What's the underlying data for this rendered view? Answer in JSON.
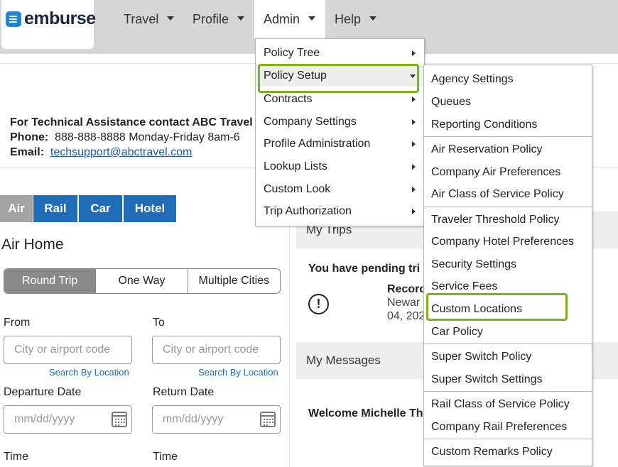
{
  "logo": {
    "text": "emburse",
    "brand_color": "#1b86d6"
  },
  "nav": [
    {
      "label": "Travel"
    },
    {
      "label": "Profile"
    },
    {
      "label": "Admin"
    },
    {
      "label": "Help"
    }
  ],
  "assistance": {
    "line1": "For Technical Assistance contact ABC Travel",
    "phone_label": "Phone:",
    "phone_value": "888-888-8888 Monday-Friday 8am-6",
    "email_label": "Email:",
    "email_value": "techsupport@abctravel.com"
  },
  "mode_tabs": [
    {
      "label": "Air",
      "active": true
    },
    {
      "label": "Rail"
    },
    {
      "label": "Car"
    },
    {
      "label": "Hotel"
    }
  ],
  "air_home": {
    "title": "Air Home",
    "trip_types": [
      "Round Trip",
      "One Way",
      "Multiple Cities"
    ],
    "from_label": "From",
    "to_label": "To",
    "from_placeholder": "City or airport code",
    "to_placeholder": "City or airport code",
    "search_by_location": "Search By Location",
    "departure_label": "Departure Date",
    "return_label": "Return Date",
    "date_placeholder": "mm/dd/yyyy",
    "time_label": "Time"
  },
  "right": {
    "my_trips": "My Trips",
    "pending_text": "You have pending tri",
    "record": "Record",
    "newark": "Newar",
    "date_partial": "04, 202",
    "my_messages": "My Messages",
    "welcome": "Welcome Michelle Th"
  },
  "admin_menu": [
    {
      "label": "Policy Tree"
    },
    {
      "label": "Policy Setup"
    },
    {
      "label": "Contracts"
    },
    {
      "label": "Company Settings"
    },
    {
      "label": "Profile Administration"
    },
    {
      "label": "Lookup Lists"
    },
    {
      "label": "Custom Look"
    },
    {
      "label": "Trip Authorization"
    }
  ],
  "policy_setup_menu": [
    {
      "label": "Agency Settings"
    },
    {
      "label": "Queues"
    },
    {
      "label": "Reporting Conditions"
    },
    {
      "label": "Air Reservation Policy"
    },
    {
      "label": "Company Air Preferences"
    },
    {
      "label": "Air Class of Service Policy"
    },
    {
      "label": "Traveler Threshold Policy"
    },
    {
      "label": "Company Hotel Preferences"
    },
    {
      "label": "Security Settings"
    },
    {
      "label": "Service Fees"
    },
    {
      "label": "Custom Locations"
    },
    {
      "label": "Car Policy"
    },
    {
      "label": "Super Switch Policy"
    },
    {
      "label": "Super Switch Settings"
    },
    {
      "label": "Rail Class of Service Policy"
    },
    {
      "label": "Company Rail Preferences"
    },
    {
      "label": "Custom Remarks Policy"
    }
  ],
  "highlight_color": "#7ab317"
}
